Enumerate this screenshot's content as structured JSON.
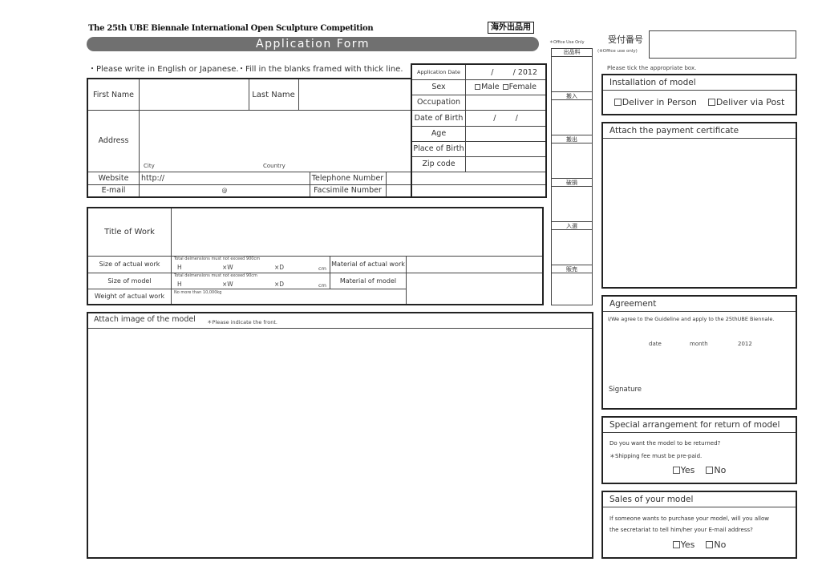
{
  "header": {
    "competition_title": "The 25th UBE Biennale International Open Sculpture Competition",
    "overseas_badge": "海外出品用",
    "form_title": "Application Form",
    "instruction_1": "・Please write in English or Japanese.",
    "instruction_2": "・Fill in the blanks framed with thick line."
  },
  "applicant": {
    "application_date_label": "Application Date",
    "application_date_value": "/        / 2012",
    "first_name_label": "First Name",
    "last_name_label": "Last Name",
    "address_label": "Address",
    "city_label": "City",
    "country_label": "Country",
    "website_label": "Website",
    "website_value": "http://",
    "email_label": "E-mail",
    "email_at": "@",
    "telephone_label": "Telephone Number",
    "facsimile_label": "Facsimile Number",
    "sex_label": "Sex",
    "sex_options": [
      "Male",
      "Female"
    ],
    "occupation_label": "Occupation",
    "dob_label": "Date of Birth",
    "dob_value": "/        /",
    "age_label": "Age",
    "place_of_birth_label": "Place of Birth",
    "zip_label": "Zip code"
  },
  "work": {
    "title_label": "Title of Work",
    "actual_size_label": "Size of actual work",
    "actual_size_note": "Total deimensions must not exceed 900cm",
    "model_size_label": "Size of model",
    "model_size_note": "Total deimensions must not exceed 90cm",
    "dim_h": "H",
    "dim_w": "×W",
    "dim_d": "×D",
    "dim_unit": "cm",
    "weight_label": "Weight of actual work",
    "weight_note": "No more than 10,000kg",
    "material_actual_label": "Material of actual work",
    "material_model_label": "Material of model"
  },
  "image_section": {
    "label": "Attach image of the model",
    "note": "＊Please indicate the front."
  },
  "office_use": {
    "note": "＊Office Use Only",
    "columns": [
      "出品料",
      "搬入",
      "搬出",
      "破損",
      "入選",
      "販売"
    ],
    "reception_number_label": "受付番号",
    "reception_number_note": "(※Office use only)"
  },
  "installation": {
    "hint": "Please tick the appropriate box.",
    "title": "Installation of model",
    "options": [
      "Deliver in Person",
      "Deliver via Post"
    ]
  },
  "payment": {
    "title": "Attach the payment certificate"
  },
  "agreement": {
    "title": "Agreement",
    "text": "I/We agree to the Guideline and apply to the 25thUBE Biennale.",
    "date_label": "date",
    "month_label": "month",
    "year": "2012",
    "signature_label": "Signature"
  },
  "return_model": {
    "title": "Special arrangement for return of model",
    "question": "Do you want the model to be returned?",
    "note": "＊Shipping fee must be pre-paid.",
    "options": [
      "Yes",
      "No"
    ]
  },
  "sales": {
    "title": "Sales of your model",
    "question_1": "If someone wants to purchase your model, will you allow",
    "question_2": "the secretariat to tell him/her your E-mail address?",
    "options": [
      "Yes",
      "No"
    ]
  }
}
